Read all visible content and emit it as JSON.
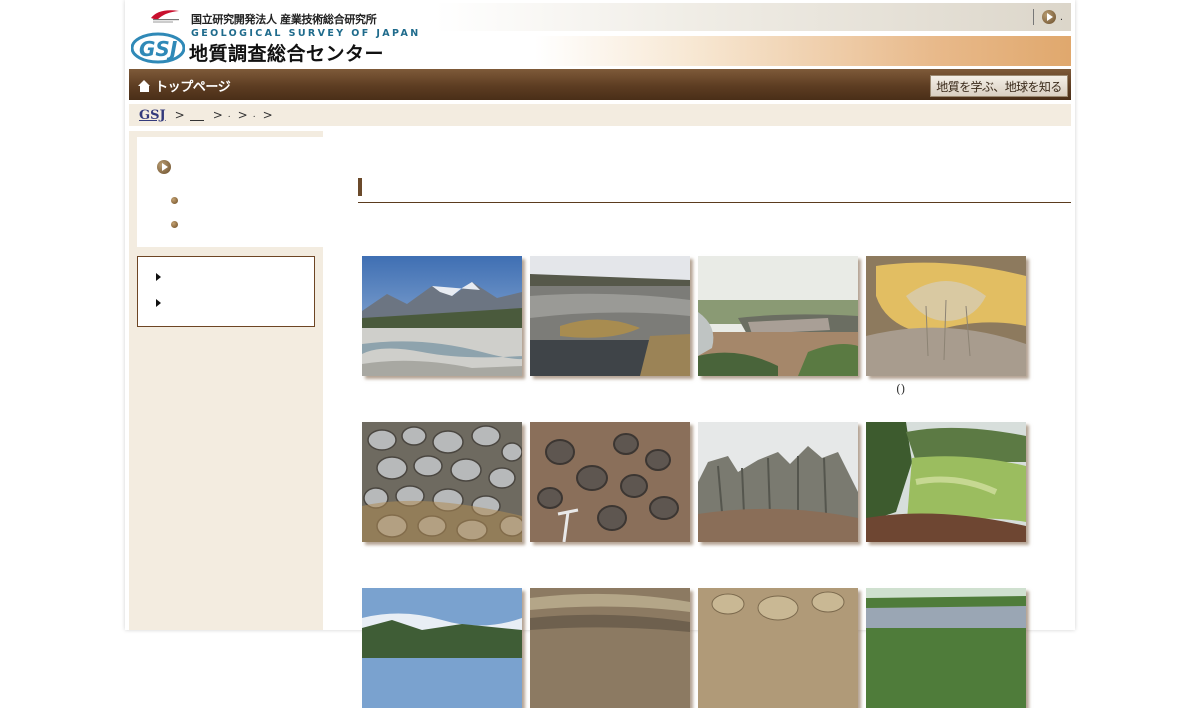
{
  "header": {
    "org_name": "国立研究開発法人 産業技術総合研究所",
    "gsj_english": "GEOLOGICAL SURVEY OF JAPAN",
    "gsj_japanese": "地質調査総合センター",
    "top_link_suffix": "."
  },
  "nav": {
    "home_label": "トップページ",
    "learn_label": "地質を学ぶ、地球を知る"
  },
  "breadcrumb": {
    "root": "GSJ",
    "sep": ">",
    "dot": "."
  },
  "gallery": {
    "captions": [
      "",
      "",
      "",
      "()",
      "",
      "",
      "",
      "",
      "",
      "",
      "",
      ""
    ]
  },
  "colors": {
    "nav_brown": "#5d3d22",
    "sidebar_bg": "#f3ece0",
    "link_blue": "#333a7c"
  }
}
